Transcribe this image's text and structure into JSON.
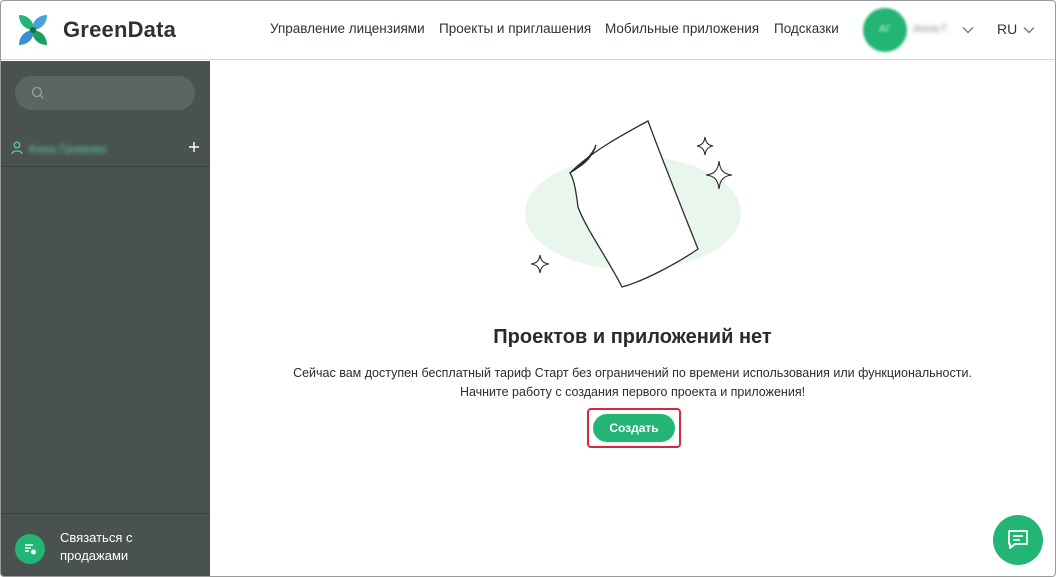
{
  "header": {
    "brand": "GreenData",
    "nav": [
      {
        "label": "Управление лицензиями"
      },
      {
        "label": "Проекты и приглашения"
      },
      {
        "label": "Мобильные приложения"
      },
      {
        "label": "Подсказки"
      }
    ],
    "avatar_initials": "АГ",
    "username": "Анна Г.",
    "language": "RU"
  },
  "sidebar": {
    "search_placeholder": "",
    "user_name": "Анна Громова",
    "sales_label": "Связаться с продажами"
  },
  "main": {
    "empty_title": "Проектов и приложений нет",
    "empty_line1": "Сейчас вам доступен бесплатный тариф Старт без ограничений по времени использования или функциональности.",
    "empty_line2": "Начните работу с создания первого проекта и приложения!",
    "create_label": "Создать"
  },
  "colors": {
    "accent": "#22b573",
    "sidebar_bg": "#4a5151",
    "highlight": "#d7263d"
  },
  "icons": [
    "logo-icon",
    "chevron-down-icon",
    "search-icon",
    "user-icon",
    "plus-icon",
    "sales-icon",
    "chat-icon",
    "sparkle-icon",
    "document-icon"
  ]
}
